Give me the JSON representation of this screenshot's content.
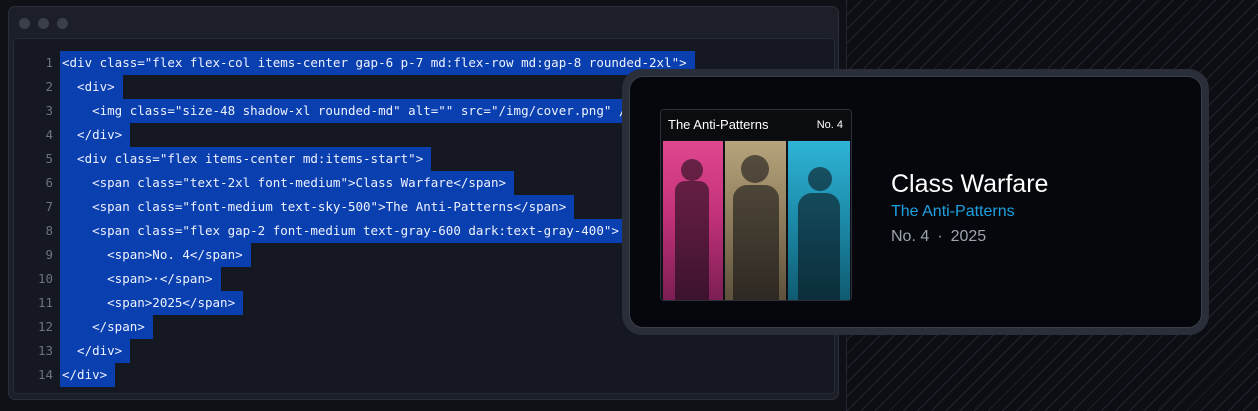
{
  "code": {
    "lines": [
      {
        "num": "1",
        "text": "<div class=\"flex flex-col items-center gap-6 p-7 md:flex-row md:gap-8 rounded-2xl\">"
      },
      {
        "num": "2",
        "text": "  <div>"
      },
      {
        "num": "3",
        "text": "    <img class=\"size-48 shadow-xl rounded-md\" alt=\"\" src=\"/img/cover.png\" />"
      },
      {
        "num": "4",
        "text": "  </div>"
      },
      {
        "num": "5",
        "text": "  <div class=\"flex items-center md:items-start\">"
      },
      {
        "num": "6",
        "text": "    <span class=\"text-2xl font-medium\">Class Warfare</span>"
      },
      {
        "num": "7",
        "text": "    <span class=\"font-medium text-sky-500\">The Anti-Patterns</span>"
      },
      {
        "num": "8",
        "text": "    <span class=\"flex gap-2 font-medium text-gray-600 dark:text-gray-400\">"
      },
      {
        "num": "9",
        "text": "      <span>No. 4</span>"
      },
      {
        "num": "10",
        "text": "      <span>·</span>"
      },
      {
        "num": "11",
        "text": "      <span>2025</span>"
      },
      {
        "num": "12",
        "text": "    </span>"
      },
      {
        "num": "13",
        "text": "  </div>"
      },
      {
        "num": "14",
        "text": "</div>"
      }
    ]
  },
  "preview": {
    "cover": {
      "title": "The Anti-Patterns",
      "number": "No. 4"
    },
    "song_title": "Class Warfare",
    "artist": "The Anti-Patterns",
    "meta": {
      "number": "No. 4",
      "separator": "·",
      "year": "2025"
    }
  },
  "colors": {
    "selection": "#0a3fb0",
    "artist": "#1ea0e0",
    "meta": "#9ca3af"
  }
}
